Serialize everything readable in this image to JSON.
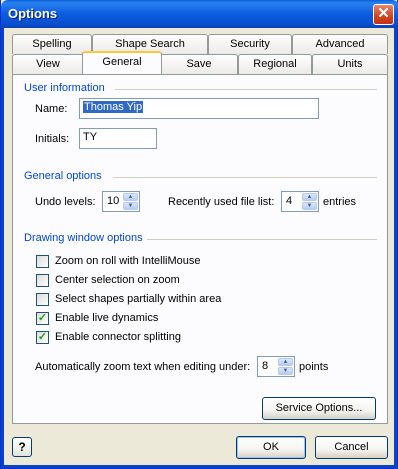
{
  "window": {
    "title": "Options",
    "close_symbol": "✕"
  },
  "tabs_back": [
    "Spelling",
    "Shape Search",
    "Security",
    "Advanced"
  ],
  "tabs_front": [
    "View",
    "General",
    "Save",
    "Regional",
    "Units"
  ],
  "active_tab": "General",
  "user_info": {
    "title": "User information",
    "name_label": "Name:",
    "name_value": "Thomas Yip",
    "initials_label": "Initials:",
    "initials_value": "TY"
  },
  "general_options": {
    "title": "General options",
    "undo_label": "Undo levels:",
    "undo_value": "10",
    "recent_label": "Recently used file list:",
    "recent_value": "4",
    "recent_suffix": "entries"
  },
  "drawing": {
    "title": "Drawing window options",
    "checkboxes": [
      {
        "label": "Zoom on roll with IntelliMouse",
        "checked": false
      },
      {
        "label": "Center selection on zoom",
        "checked": false
      },
      {
        "label": "Select shapes partially within area",
        "checked": false
      },
      {
        "label": "Enable live dynamics",
        "checked": true
      },
      {
        "label": "Enable connector splitting",
        "checked": true
      }
    ],
    "zoom_label": "Automatically zoom text when editing under:",
    "zoom_value": "8",
    "zoom_suffix": "points"
  },
  "buttons": {
    "service_options": "Service Options...",
    "ok": "OK",
    "cancel": "Cancel",
    "help": "?"
  }
}
